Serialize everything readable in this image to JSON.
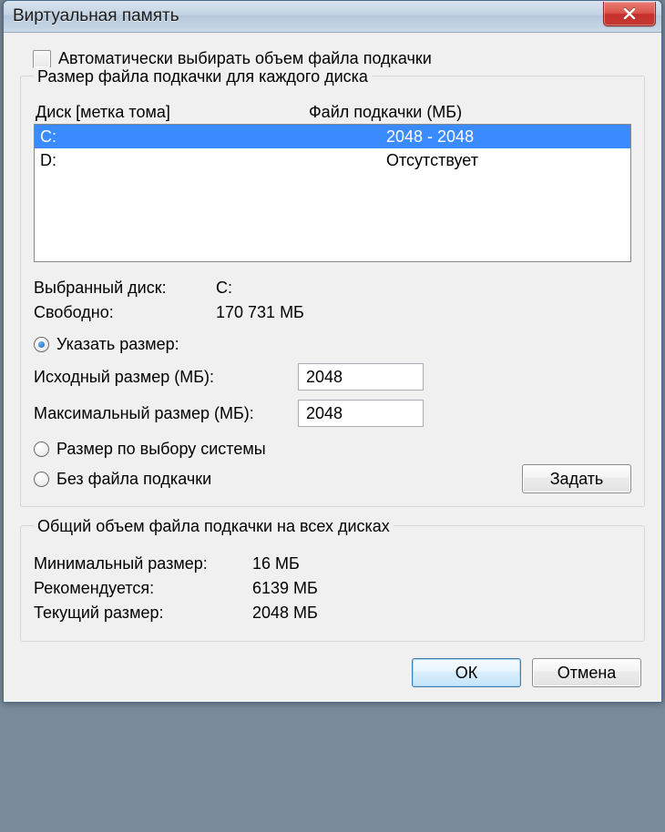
{
  "window": {
    "title": "Виртуальная память"
  },
  "auto_manage": {
    "label": "Автоматически выбирать объем файла подкачки",
    "checked": false
  },
  "per_drive": {
    "group_title": "Размер файла подкачки для каждого диска",
    "columns": {
      "drive": "Диск [метка тома]",
      "pagefile": "Файл подкачки (МБ)"
    },
    "rows": [
      {
        "drive": "C:",
        "pagefile": "2048 - 2048",
        "selected": true
      },
      {
        "drive": "D:",
        "pagefile": "Отсутствует",
        "selected": false
      }
    ],
    "selected_label": "Выбранный диск:",
    "selected_value": "C:",
    "free_label": "Свободно:",
    "free_value": "170 731 МБ",
    "options": {
      "custom": "Указать размер:",
      "system": "Размер по выбору системы",
      "none": "Без файла подкачки",
      "selected": "custom"
    },
    "initial_label": "Исходный размер (МБ):",
    "initial_value": "2048",
    "max_label": "Максимальный размер (МБ):",
    "max_value": "2048",
    "set_button": "Задать"
  },
  "totals": {
    "group_title": "Общий объем файла подкачки на всех дисках",
    "min_label": "Минимальный размер:",
    "min_value": "16 МБ",
    "rec_label": "Рекомендуется:",
    "rec_value": "6139 МБ",
    "cur_label": "Текущий размер:",
    "cur_value": "2048 МБ"
  },
  "buttons": {
    "ok": "ОК",
    "cancel": "Отмена"
  }
}
